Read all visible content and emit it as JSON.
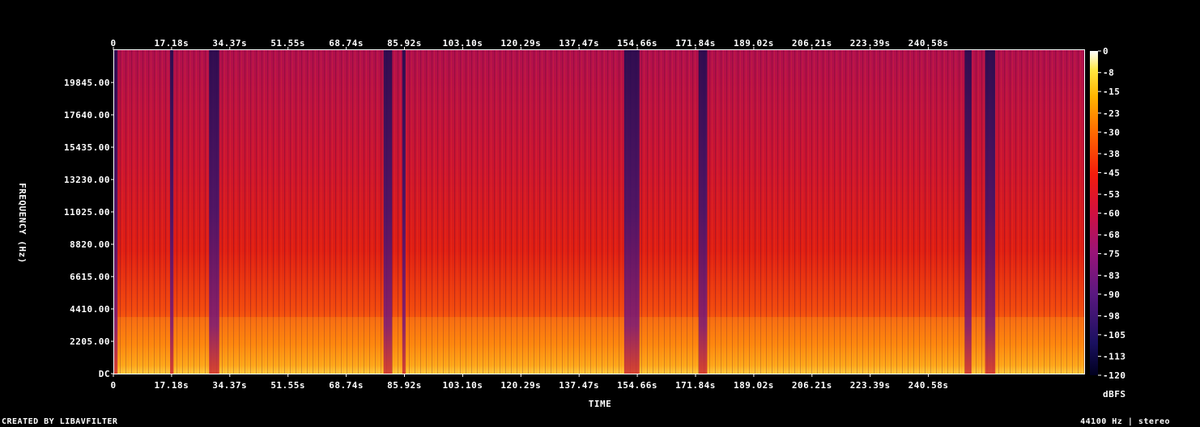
{
  "chart_data": {
    "type": "heatmap",
    "xlabel": "TIME",
    "ylabel": "FREQUENCY (Hz)",
    "x_ticks": [
      "0",
      "17.18s",
      "34.37s",
      "51.55s",
      "68.74s",
      "85.92s",
      "103.10s",
      "120.29s",
      "137.47s",
      "154.66s",
      "171.84s",
      "189.02s",
      "206.21s",
      "223.39s",
      "240.58s"
    ],
    "y_ticks": [
      "DC",
      "2205.00",
      "4410.00",
      "6615.00",
      "8820.00",
      "11025.00",
      "13230.00",
      "15435.00",
      "17640.00",
      "19845.00"
    ],
    "y_range_hz": [
      0,
      22050
    ],
    "colorbar_label": "dBFS",
    "colorbar_ticks": [
      "0",
      "-8",
      "-15",
      "-23",
      "-30",
      "-38",
      "-45",
      "-53",
      "-60",
      "-68",
      "-75",
      "-83",
      "-90",
      "-98",
      "-105",
      "-113",
      "-120"
    ],
    "colorbar_range_db": [
      -120,
      0
    ],
    "quiet_sections_s": [
      [
        0,
        1
      ],
      [
        16.5,
        17.5
      ],
      [
        28,
        31
      ],
      [
        79.5,
        82
      ],
      [
        85,
        86
      ],
      [
        150.5,
        155
      ],
      [
        172.5,
        175
      ],
      [
        251,
        253
      ],
      [
        257,
        260
      ]
    ],
    "colors": {
      "background": "#000000",
      "text": "#ffffff"
    }
  },
  "footer": {
    "left": "CREATED BY LIBAVFILTER",
    "right": "44100 Hz | stereo"
  }
}
